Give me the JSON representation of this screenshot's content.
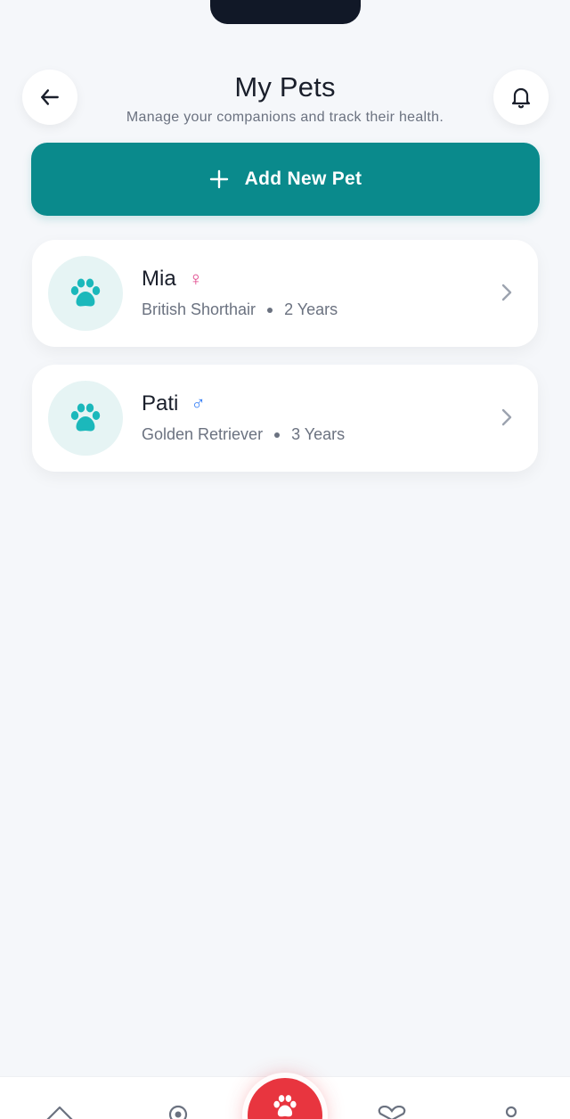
{
  "header": {
    "title": "My Pets",
    "subtitle": "Manage your companions and track their health.",
    "back_icon": "arrow-left-icon",
    "bell_icon": "bell-icon"
  },
  "add_button": {
    "label": "Add New Pet",
    "icon": "plus-icon",
    "color": "#0a8a8c"
  },
  "pets": [
    {
      "name": "Mia",
      "gender_symbol": "♀",
      "gender_color": "#e0448a",
      "breed": "British Shorthair",
      "age": "2 Years"
    },
    {
      "name": "Pati",
      "gender_symbol": "♂",
      "gender_color": "#3b82f6",
      "breed": "Golden Retriever",
      "age": "3 Years"
    }
  ],
  "colors": {
    "accent": "#0a8a8c",
    "paw": "#1bb8bb",
    "center_tab": "#e8353f",
    "background": "#f5f7fa"
  },
  "tabbar": {
    "icons": [
      "home-icon",
      "location-icon",
      "paw-icon",
      "heart-icon",
      "profile-icon"
    ]
  }
}
